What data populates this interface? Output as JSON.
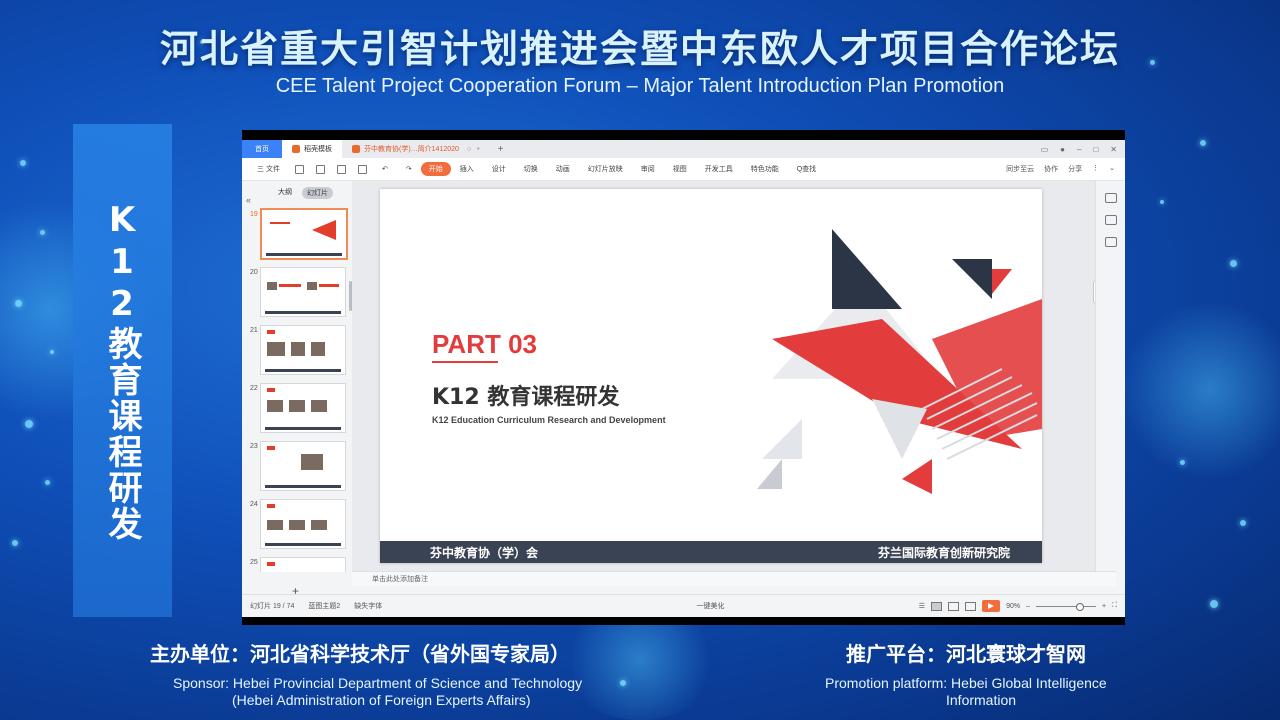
{
  "banner": {
    "title_cn": "河北省重大引智计划推进会暨中东欧人才项目合作论坛",
    "title_en": "CEE Talent Project Cooperation Forum – Major Talent Introduction Plan Promotion",
    "side_label": "K12教育课程研发"
  },
  "footer": {
    "sponsor_cn": "主办单位：河北省科学技术厅（省外国专家局）",
    "sponsor_en_line1": "Sponsor: Hebei Provincial Department of Science and Technology",
    "sponsor_en_line2": "(Hebei Administration of Foreign Experts Affairs)",
    "promo_cn": "推广平台：河北寰球才智网",
    "promo_en_line1": "Promotion platform:   Hebei Global Intelligence",
    "promo_en_line2": "Information"
  },
  "app": {
    "tabs": [
      {
        "label": "首页"
      },
      {
        "label": "稻壳模板"
      },
      {
        "label": "芬中教育协(学)…简介1412020"
      }
    ],
    "ribbon": {
      "file_menu": "三 文件",
      "start": "开始",
      "items": [
        "插入",
        "设计",
        "切换",
        "动画",
        "幻灯片放映",
        "审阅",
        "视图",
        "开发工具",
        "特色功能",
        "Q查找"
      ],
      "right_items": [
        "同步至云",
        "协作",
        "分享"
      ]
    },
    "thumbnail_panel": {
      "tab_outline": "大纲",
      "tab_slides": "幻灯片",
      "slide_numbers": [
        "19",
        "20",
        "21",
        "22",
        "23",
        "24",
        "25"
      ],
      "add_label": "+"
    },
    "slide": {
      "part": "PART 03",
      "title": "K12 教育课程研发",
      "subtitle": "K12 Education Curriculum Research and Development",
      "footer_left": "芬中教育协（学）会",
      "footer_right": "芬兰国际教育创新研究院"
    },
    "notes_placeholder": "单击此处添加备注",
    "status": {
      "slide_counter": "幻灯片 19 / 74",
      "theme": "蓝图主题2",
      "font_missing": "缺失字体",
      "beautify": "一键美化",
      "zoom": "90%"
    },
    "colors": {
      "accent_orange": "#f26d3d",
      "slide_red": "#e23c3c",
      "slide_navy": "#2b3546"
    }
  }
}
